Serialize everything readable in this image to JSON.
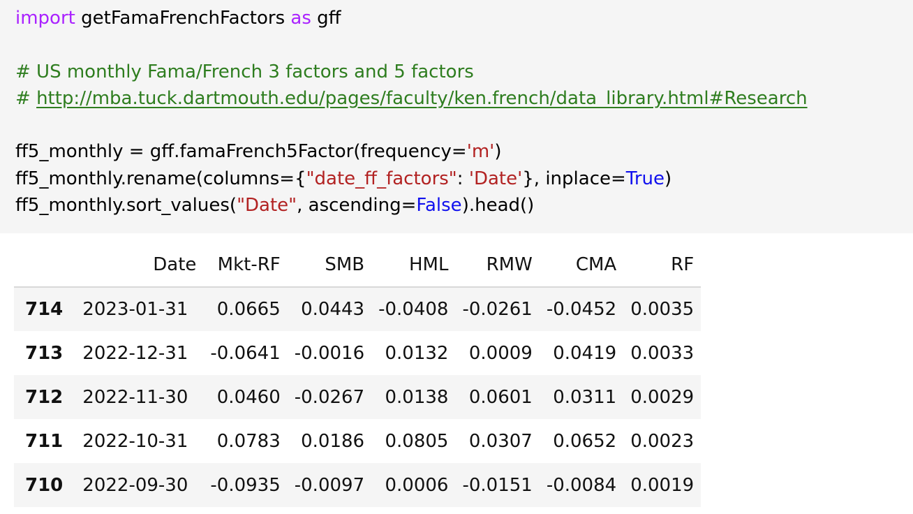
{
  "code_cell": {
    "line1": {
      "kw_import": "import",
      "module": " getFamaFrenchFactors ",
      "kw_as": "as",
      "alias": " gff"
    },
    "comment1": "# US monthly Fama/French 3 factors and 5 factors",
    "comment2_prefix": "# ",
    "comment2_link": "http://mba.tuck.dartmouth.edu/pages/faculty/ken.french/data_library.html#Research",
    "line4": {
      "pre": "ff5_monthly = gff.famaFrench5Factor(frequency=",
      "str": "'m'",
      "post": ")"
    },
    "line5": {
      "pre": "ff5_monthly.rename(columns={",
      "str1": "\"date_ff_factors\"",
      "mid": ": ",
      "str2": "'Date'",
      "mid2": "}, inplace=",
      "bool": "True",
      "post": ")"
    },
    "line6": {
      "pre": "ff5_monthly.sort_values(",
      "str": "\"Date\"",
      "mid": ", ascending=",
      "bool": "False",
      "post": ").head()"
    }
  },
  "output_table": {
    "columns": [
      "Date",
      "Mkt-RF",
      "SMB",
      "HML",
      "RMW",
      "CMA",
      "RF"
    ],
    "rows": [
      {
        "index": "714",
        "values": [
          "2023-01-31",
          "0.0665",
          "0.0443",
          "-0.0408",
          "-0.0261",
          "-0.0452",
          "0.0035"
        ]
      },
      {
        "index": "713",
        "values": [
          "2022-12-31",
          "-0.0641",
          "-0.0016",
          "0.0132",
          "0.0009",
          "0.0419",
          "0.0033"
        ]
      },
      {
        "index": "712",
        "values": [
          "2022-11-30",
          "0.0460",
          "-0.0267",
          "0.0138",
          "0.0601",
          "0.0311",
          "0.0029"
        ]
      },
      {
        "index": "711",
        "values": [
          "2022-10-31",
          "0.0783",
          "0.0186",
          "0.0805",
          "0.0307",
          "0.0652",
          "0.0023"
        ]
      },
      {
        "index": "710",
        "values": [
          "2022-09-30",
          "-0.0935",
          "-0.0097",
          "0.0006",
          "-0.0151",
          "-0.0084",
          "0.0019"
        ]
      }
    ]
  },
  "colors": {
    "keyword": "#aa22ff",
    "comment": "#2e7d1f",
    "string": "#b22222",
    "boolean": "#1111ee",
    "cell_background": "#f5f5f5"
  }
}
